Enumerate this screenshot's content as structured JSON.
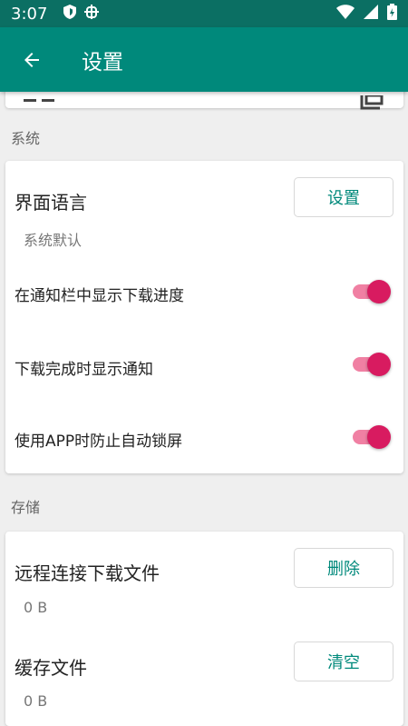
{
  "status_bar": {
    "time": "3:07"
  },
  "app_bar": {
    "title": "设置"
  },
  "sections": {
    "system": {
      "label": "系统",
      "language": {
        "title": "界面语言",
        "button": "设置",
        "value": "系统默认"
      },
      "toggles": [
        {
          "label": "在通知栏中显示下载进度",
          "on": true
        },
        {
          "label": "下载完成时显示通知",
          "on": true
        },
        {
          "label": "使用APP时防止自动锁屏",
          "on": true
        }
      ]
    },
    "storage": {
      "label": "存储",
      "remote": {
        "title": "远程连接下载文件",
        "button": "删除",
        "size": "0 B"
      },
      "cache": {
        "title": "缓存文件",
        "button": "清空",
        "size": "0 B"
      }
    }
  },
  "colors": {
    "primary": "#00897b",
    "status": "#0b6f63",
    "accent": "#d81b60"
  }
}
